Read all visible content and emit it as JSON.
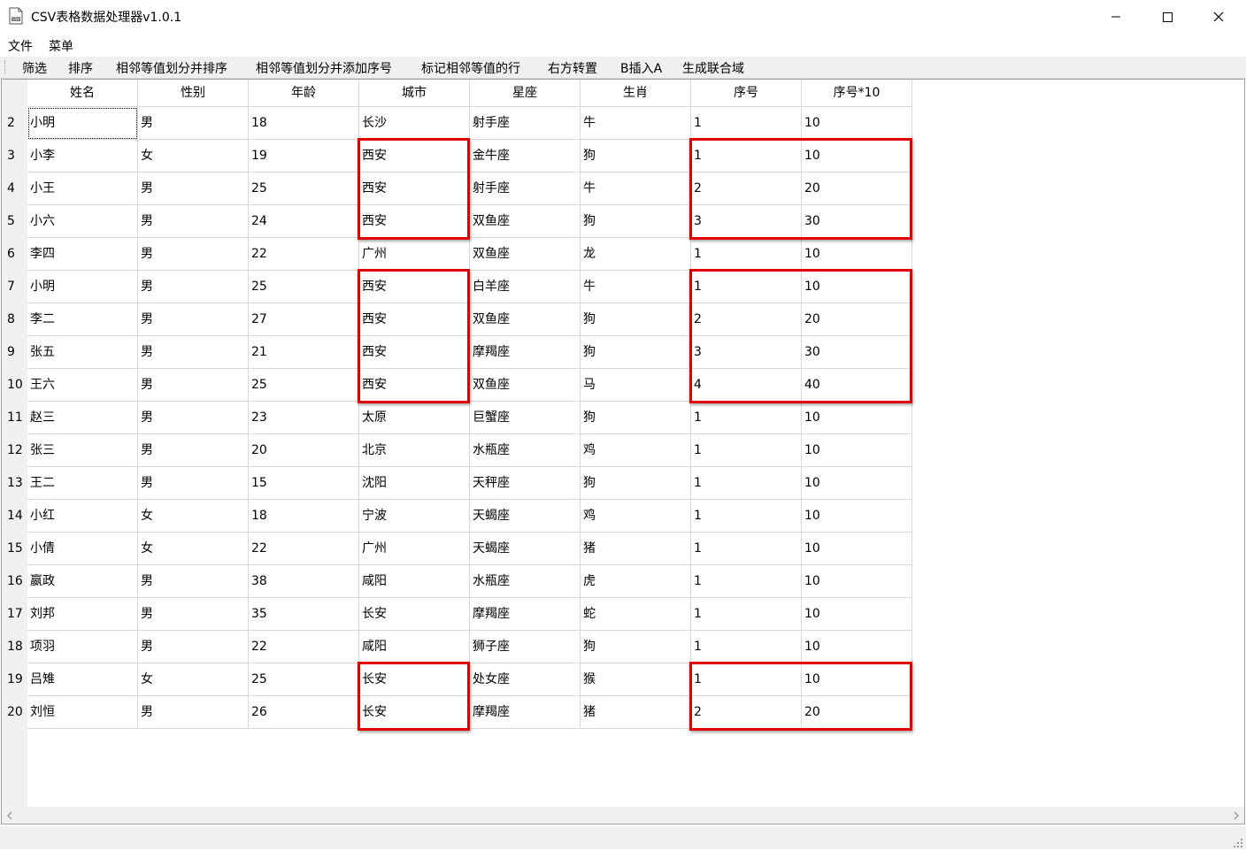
{
  "window": {
    "title": "CSV表格数据处理器v1.0.1",
    "icon": "csv-file-icon"
  },
  "menubar": {
    "items": [
      "文件",
      "菜单"
    ]
  },
  "toolbar": {
    "items": [
      "筛选",
      "排序",
      "相邻等值划分并排序",
      "相邻等值划分并添加序号",
      "标记相邻等值的行",
      "右方转置",
      "B插入A",
      "生成联合域"
    ]
  },
  "table": {
    "columns": [
      "姓名",
      "性别",
      "年龄",
      "城市",
      "星座",
      "生肖",
      "序号",
      "序号*10"
    ],
    "rows": [
      {
        "num": "2",
        "cells": [
          "小明",
          "男",
          "18",
          "长沙",
          "射手座",
          "牛",
          "1",
          "10"
        ]
      },
      {
        "num": "3",
        "cells": [
          "小李",
          "女",
          "19",
          "西安",
          "金牛座",
          "狗",
          "1",
          "10"
        ]
      },
      {
        "num": "4",
        "cells": [
          "小王",
          "男",
          "25",
          "西安",
          "射手座",
          "牛",
          "2",
          "20"
        ]
      },
      {
        "num": "5",
        "cells": [
          "小六",
          "男",
          "24",
          "西安",
          "双鱼座",
          "狗",
          "3",
          "30"
        ]
      },
      {
        "num": "6",
        "cells": [
          "李四",
          "男",
          "22",
          "广州",
          "双鱼座",
          "龙",
          "1",
          "10"
        ]
      },
      {
        "num": "7",
        "cells": [
          "小明",
          "男",
          "25",
          "西安",
          "白羊座",
          "牛",
          "1",
          "10"
        ]
      },
      {
        "num": "8",
        "cells": [
          "李二",
          "男",
          "27",
          "西安",
          "双鱼座",
          "狗",
          "2",
          "20"
        ]
      },
      {
        "num": "9",
        "cells": [
          "张五",
          "男",
          "21",
          "西安",
          "摩羯座",
          "狗",
          "3",
          "30"
        ]
      },
      {
        "num": "10",
        "cells": [
          "王六",
          "男",
          "25",
          "西安",
          "双鱼座",
          "马",
          "4",
          "40"
        ]
      },
      {
        "num": "11",
        "cells": [
          "赵三",
          "男",
          "23",
          "太原",
          "巨蟹座",
          "狗",
          "1",
          "10"
        ]
      },
      {
        "num": "12",
        "cells": [
          "张三",
          "男",
          "20",
          "北京",
          "水瓶座",
          "鸡",
          "1",
          "10"
        ]
      },
      {
        "num": "13",
        "cells": [
          "王二",
          "男",
          "15",
          "沈阳",
          "天秤座",
          "狗",
          "1",
          "10"
        ]
      },
      {
        "num": "14",
        "cells": [
          "小红",
          "女",
          "18",
          "宁波",
          "天蝎座",
          "鸡",
          "1",
          "10"
        ]
      },
      {
        "num": "15",
        "cells": [
          "小倩",
          "女",
          "22",
          "广州",
          "天蝎座",
          "猪",
          "1",
          "10"
        ]
      },
      {
        "num": "16",
        "cells": [
          "嬴政",
          "男",
          "38",
          "咸阳",
          "水瓶座",
          "虎",
          "1",
          "10"
        ]
      },
      {
        "num": "17",
        "cells": [
          "刘邦",
          "男",
          "35",
          "长安",
          "摩羯座",
          "蛇",
          "1",
          "10"
        ]
      },
      {
        "num": "18",
        "cells": [
          "项羽",
          "男",
          "22",
          "咸阳",
          "狮子座",
          "狗",
          "1",
          "10"
        ]
      },
      {
        "num": "19",
        "cells": [
          "吕雉",
          "女",
          "25",
          "长安",
          "处女座",
          "猴",
          "1",
          "10"
        ]
      },
      {
        "num": "20",
        "cells": [
          "刘恒",
          "男",
          "26",
          "长安",
          "摩羯座",
          "猪",
          "2",
          "20"
        ]
      }
    ]
  },
  "highlights": {
    "color": "#e00000",
    "groups": [
      {
        "rows": [
          "3",
          "5"
        ],
        "columns": [
          "城市"
        ]
      },
      {
        "rows": [
          "3",
          "5"
        ],
        "columns": [
          "序号",
          "序号*10"
        ]
      },
      {
        "rows": [
          "7",
          "10"
        ],
        "columns": [
          "城市"
        ]
      },
      {
        "rows": [
          "7",
          "10"
        ],
        "columns": [
          "序号",
          "序号*10"
        ]
      },
      {
        "rows": [
          "19",
          "20"
        ],
        "columns": [
          "城市"
        ]
      },
      {
        "rows": [
          "19",
          "20"
        ],
        "columns": [
          "序号",
          "序号*10"
        ]
      }
    ]
  }
}
